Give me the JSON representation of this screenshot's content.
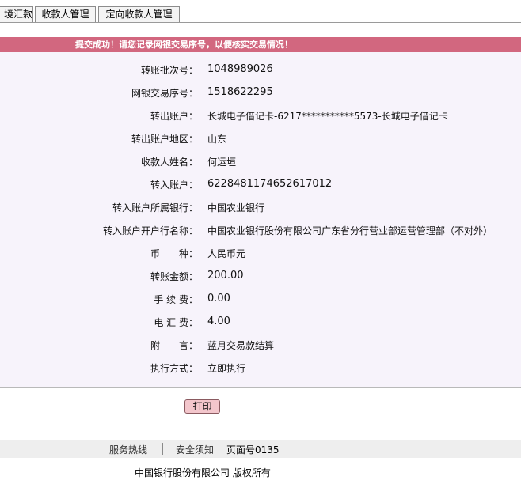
{
  "tabs": [
    {
      "label": "境汇款"
    },
    {
      "label": "收款人管理"
    },
    {
      "label": "定向收款人管理"
    }
  ],
  "banner": "提交成功！请您记录网银交易序号，以便核实交易情况！",
  "fields": [
    {
      "label": "转账批次号：",
      "value": "1048989026"
    },
    {
      "label": "网银交易序号：",
      "value": "1518622295"
    },
    {
      "label": "转出账户：",
      "value": "长城电子借记卡-6217***********5573-长城电子借记卡"
    },
    {
      "label": "转出账户地区：",
      "value": "山东"
    },
    {
      "label": "收款人姓名：",
      "value": "何运垣"
    },
    {
      "label": "转入账户：",
      "value": "6228481174652617012"
    },
    {
      "label": "转入账户所属银行：",
      "value": "中国农业银行"
    },
    {
      "label": "转入账户开户行名称：",
      "value": "中国农业银行股份有限公司广东省分行营业部运营管理部（不对外）"
    },
    {
      "label": "币　　种：",
      "value": "人民币元"
    },
    {
      "label": "转账金额：",
      "value": "200.00"
    },
    {
      "label": "手 续 费：",
      "value": "0.00"
    },
    {
      "label": "电 汇 费：",
      "value": "4.00"
    },
    {
      "label": "附　　言：",
      "value": "蓝月交易款结算"
    },
    {
      "label": "执行方式：",
      "value": "立即执行"
    }
  ],
  "print_label": "打印",
  "footer": {
    "hotline": "服务热线",
    "security": "安全须知",
    "page_no": "页面号0135",
    "copyright": "中国银行股份有限公司  版权所有"
  },
  "colors": {
    "banner": "#d2677f",
    "panel": "#f7f3fb",
    "print_button": "#f3c6cc"
  }
}
